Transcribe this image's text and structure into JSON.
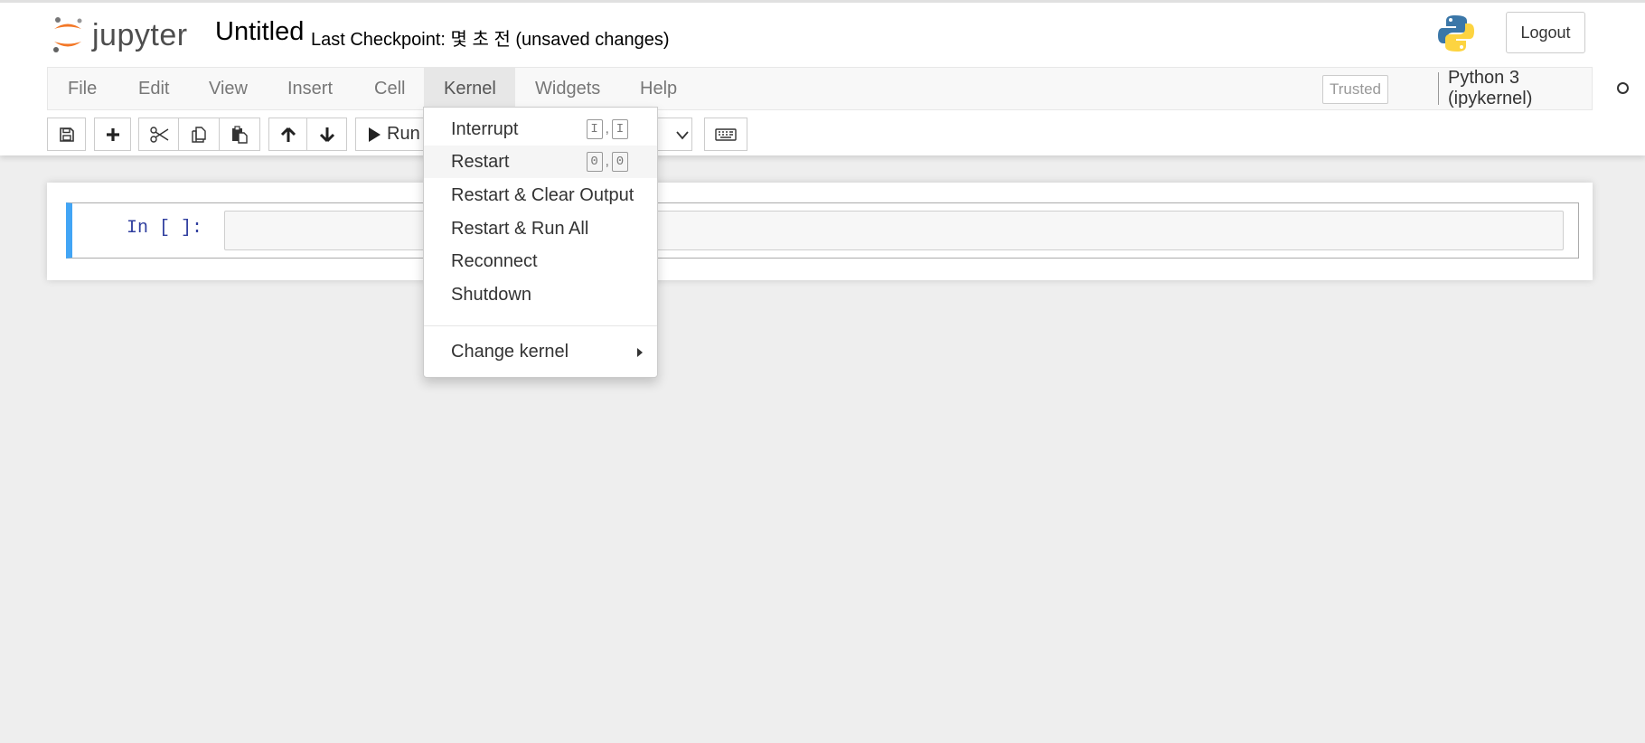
{
  "header": {
    "logo_text": "jupyter",
    "notebook_title": "Untitled",
    "checkpoint": "Last Checkpoint: 몇 초 전  (unsaved changes)",
    "logout_label": "Logout"
  },
  "menubar": {
    "items": [
      "File",
      "Edit",
      "View",
      "Insert",
      "Cell",
      "Kernel",
      "Widgets",
      "Help"
    ],
    "trusted_label": "Trusted",
    "kernel_name": "Python 3 (ipykernel)"
  },
  "toolbar": {
    "run_label": "Run",
    "icons": [
      "save-icon",
      "plus-icon",
      "cut-icon",
      "copy-icon",
      "paste-icon",
      "arrow-up-icon",
      "arrow-down-icon",
      "play-icon",
      "keyboard-icon"
    ]
  },
  "kernel_menu": {
    "items": [
      {
        "label": "Interrupt",
        "shortcut": [
          "I",
          "I"
        ]
      },
      {
        "label": "Restart",
        "shortcut": [
          "0",
          "0"
        ]
      },
      {
        "label": "Restart & Clear Output"
      },
      {
        "label": "Restart & Run All"
      },
      {
        "label": "Reconnect"
      },
      {
        "label": "Shutdown"
      },
      {
        "label": "Change kernel"
      }
    ]
  },
  "cell": {
    "prompt": "In [ ]:",
    "code": ""
  },
  "colors": {
    "accent": "#42a5f5",
    "jupyter_orange": "#f37726",
    "background": "#eeeeee"
  }
}
